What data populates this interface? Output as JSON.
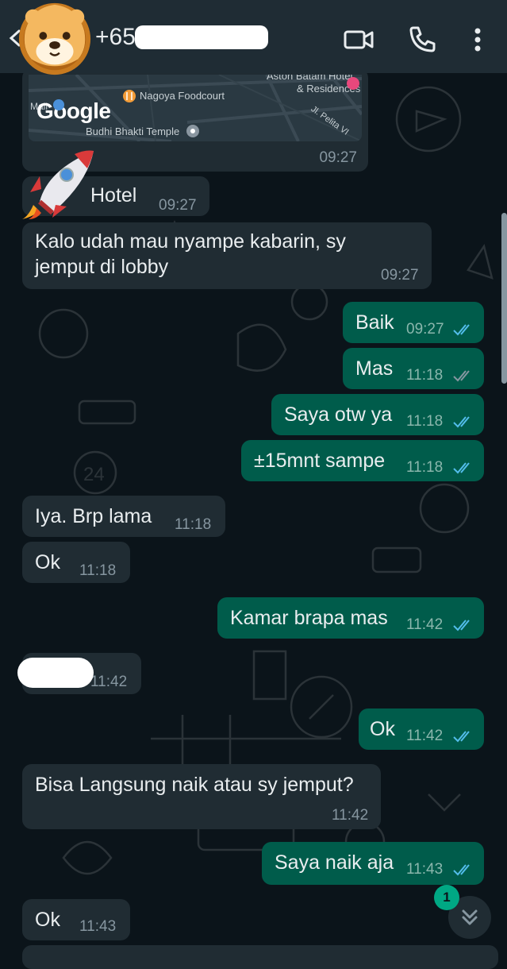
{
  "header": {
    "contact_name": "+658"
  },
  "map": {
    "labels": {
      "foodcourt": "Nagoya Foodcourt",
      "hotel_line1": "Aston Batam Hotel",
      "hotel_line2": "& Residences",
      "temple": "Budhi Bhakti Temple",
      "mall": "Mall",
      "street": "Jl. Pelita VI"
    },
    "logo_text": "Google",
    "time": "09:27"
  },
  "messages": [
    {
      "dir": "in",
      "text": "Hotel",
      "time": "09:27"
    },
    {
      "dir": "in",
      "text_line1": "Kalo udah mau nyampe kabarin, sy",
      "text_line2": "jemput di lobby",
      "time": "09:27"
    },
    {
      "dir": "out",
      "text": "Baik",
      "time": "09:27",
      "status": "read"
    },
    {
      "dir": "out",
      "text": "Mas",
      "time": "11:18",
      "status": "delivered"
    },
    {
      "dir": "out",
      "text": "Saya otw ya",
      "time": "11:18",
      "status": "read"
    },
    {
      "dir": "out",
      "text": "±15mnt sampe",
      "time": "11:18",
      "status": "read"
    },
    {
      "dir": "in",
      "text": "Iya. Brp lama",
      "time": "11:18"
    },
    {
      "dir": "in",
      "text": "Ok",
      "time": "11:18"
    },
    {
      "dir": "out",
      "text": "Kamar brapa mas",
      "time": "11:42",
      "status": "read"
    },
    {
      "dir": "in",
      "text": "",
      "time": "11:42"
    },
    {
      "dir": "out",
      "text": "Ok",
      "time": "11:42",
      "status": "read"
    },
    {
      "dir": "in",
      "text": "Bisa Langsung naik atau sy jemput?",
      "time": "11:42"
    },
    {
      "dir": "out",
      "text": "Saya naik aja",
      "time": "11:43",
      "status": "read"
    },
    {
      "dir": "in",
      "text": "Ok",
      "time": "11:43"
    }
  ],
  "unread_count": "1",
  "colors": {
    "background": "#0b141a",
    "header": "#1f2c34",
    "bubble_in": "#202c33",
    "bubble_out": "#005c4b",
    "read_tick": "#53bdeb",
    "accent": "#00a884"
  },
  "icons": [
    "back-arrow-icon",
    "video-call-icon",
    "voice-call-icon",
    "more-options-icon",
    "double-check-icon",
    "chevron-double-down-icon",
    "rocket-emoji",
    "lion-avatar"
  ]
}
